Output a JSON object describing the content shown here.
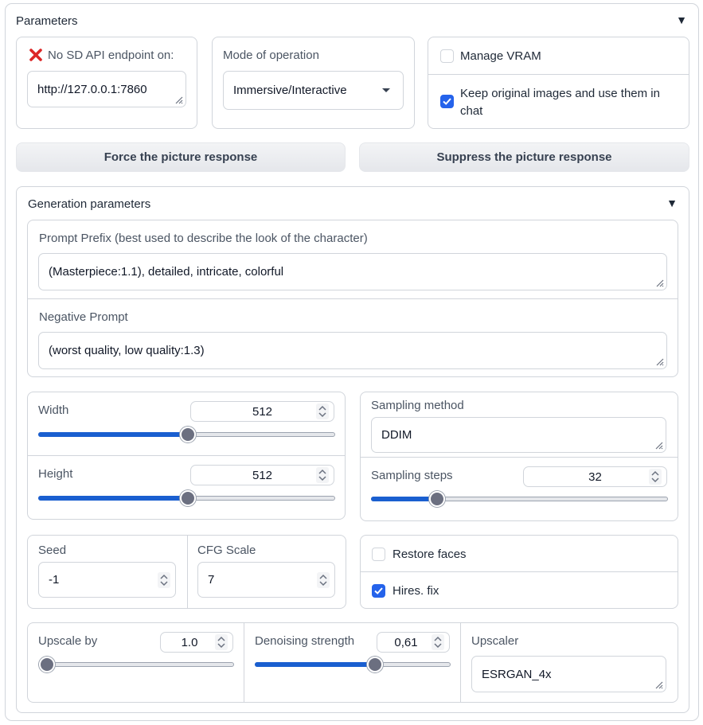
{
  "parameters": {
    "title": "Parameters",
    "endpoint": {
      "status_label": "No SD API endpoint on:",
      "value": "http://127.0.0.1:7860"
    },
    "mode": {
      "label": "Mode of operation",
      "selected": "Immersive/Interactive"
    },
    "manage_vram": {
      "label": "Manage VRAM",
      "checked": false
    },
    "keep_original": {
      "label": "Keep original images and use them in chat",
      "checked": true
    },
    "force_button": "Force the picture response",
    "suppress_button": "Suppress the picture response"
  },
  "generation": {
    "title": "Generation parameters",
    "prompt_prefix": {
      "label": "Prompt Prefix (best used to describe the look of the character)",
      "value": "(Masterpiece:1.1), detailed, intricate, colorful"
    },
    "negative_prompt": {
      "label": "Negative Prompt",
      "value": "(worst quality, low quality:1.3)"
    },
    "width": {
      "label": "Width",
      "value": "512",
      "fraction": 0.5
    },
    "height": {
      "label": "Height",
      "value": "512",
      "fraction": 0.5
    },
    "sampling_method": {
      "label": "Sampling method",
      "value": "DDIM"
    },
    "sampling_steps": {
      "label": "Sampling steps",
      "value": "32",
      "fraction": 0.22
    },
    "seed": {
      "label": "Seed",
      "value": "-1"
    },
    "cfg_scale": {
      "label": "CFG Scale",
      "value": "7"
    },
    "restore_faces": {
      "label": "Restore faces",
      "checked": false
    },
    "hires_fix": {
      "label": "Hires. fix",
      "checked": true
    },
    "upscale_by": {
      "label": "Upscale by",
      "value": "1.0",
      "fraction": 0.0
    },
    "denoising": {
      "label": "Denoising strength",
      "value": "0,61",
      "fraction": 0.61
    },
    "upscaler": {
      "label": "Upscaler",
      "value": "ESRGAN_4x"
    }
  },
  "colors": {
    "accent": "#1a5fd0",
    "checkbox": "#2563eb",
    "error_icon": "#dc2626",
    "border": "#d1d5db"
  }
}
